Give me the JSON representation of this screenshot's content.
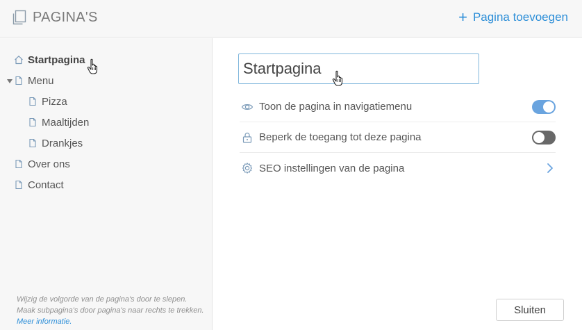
{
  "header": {
    "title": "PAGINA'S",
    "add_page_label": "Pagina toevoegen",
    "icons": {
      "pages": "pages-icon",
      "add": "plus-icon"
    }
  },
  "sidebar": {
    "items": [
      {
        "label": "Startpagina",
        "icon": "home-icon",
        "active": true
      },
      {
        "label": "Menu",
        "icon": "page-icon",
        "expanded": true
      },
      {
        "label": "Pizza",
        "icon": "page-icon"
      },
      {
        "label": "Maaltijden",
        "icon": "page-icon"
      },
      {
        "label": "Drankjes",
        "icon": "page-icon"
      },
      {
        "label": "Over ons",
        "icon": "page-icon"
      },
      {
        "label": "Contact",
        "icon": "page-icon"
      }
    ],
    "hint_text": "Wijzig de volgorde van de pagina's door te slepen. Maak subpagina's door pagina's naar rechts te trekken.",
    "hint_link": "Meer informatie."
  },
  "main": {
    "page_title_value": "Startpagina",
    "settings": [
      {
        "label": "Toon de pagina in navigatiemenu",
        "icon": "eye-icon",
        "control": "toggle",
        "enabled": true
      },
      {
        "label": "Beperk de toegang tot deze pagina",
        "icon": "lock-icon",
        "control": "toggle",
        "enabled": false
      },
      {
        "label": "SEO instellingen van de pagina",
        "icon": "gear-icon",
        "control": "chevron-right-icon"
      }
    ],
    "close_label": "Sluiten"
  },
  "colors": {
    "accent": "#2e8fd8",
    "toggle_on": "#6aa4df",
    "toggle_off": "#686868",
    "panel_bg": "#f7f7f7"
  }
}
